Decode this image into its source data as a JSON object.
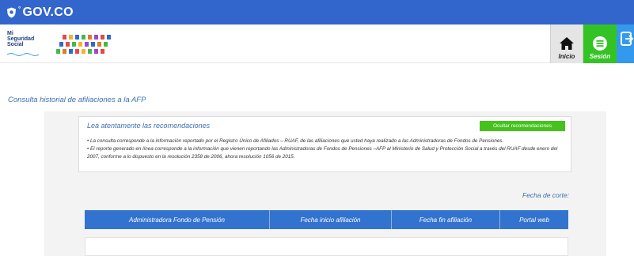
{
  "gov_bar": {
    "logo_text": "GOV.CO",
    "shield_icon": "shield-icon",
    "color": "#3366cc"
  },
  "header": {
    "brand": {
      "line1": "Mi",
      "line2": "Seguridad",
      "line3": "Social",
      "people_icon": "people-illustration-icon"
    },
    "nav": {
      "inicio_label": "Inicio",
      "inicio_icon": "home-icon",
      "sesion_label": "Sesión",
      "sesion_icon": "menu-icon",
      "salir_icon": "exit-icon",
      "sesion_color": "#34c325",
      "salir_color": "#3399ee"
    }
  },
  "main": {
    "title": "Consulta historial de afiliaciones a la AFP",
    "recommendations": {
      "title": "Lea atentamente las recomendaciones",
      "hide_button": "Ocultar recomendaciones",
      "item1": "• La consulta corresponde a la información reportado por el Registro Único de Afiliados – RUAF, de las afiliaciones que usted haya realizado a las Administradoras de Fondos de Pensiones.",
      "item2": "• El reporte generado en línea corresponde a la información que vienen reportando las Administradoras de Fondos de Pensiones –AFP al Ministerio de Salud y Protección Social a través del RUAF desde enero del 2007, conforme a lo dispuesto en la resolución 2358 de 2006, ahora resolución 1056 de 2015."
    },
    "fecha_corte_label": "Fecha de corte:",
    "table": {
      "columns": [
        "Administradora Fondo de Pensión",
        "Fecha inicio afiliación",
        "Fecha fin afiliación",
        "Portal web"
      ],
      "rows": []
    }
  }
}
